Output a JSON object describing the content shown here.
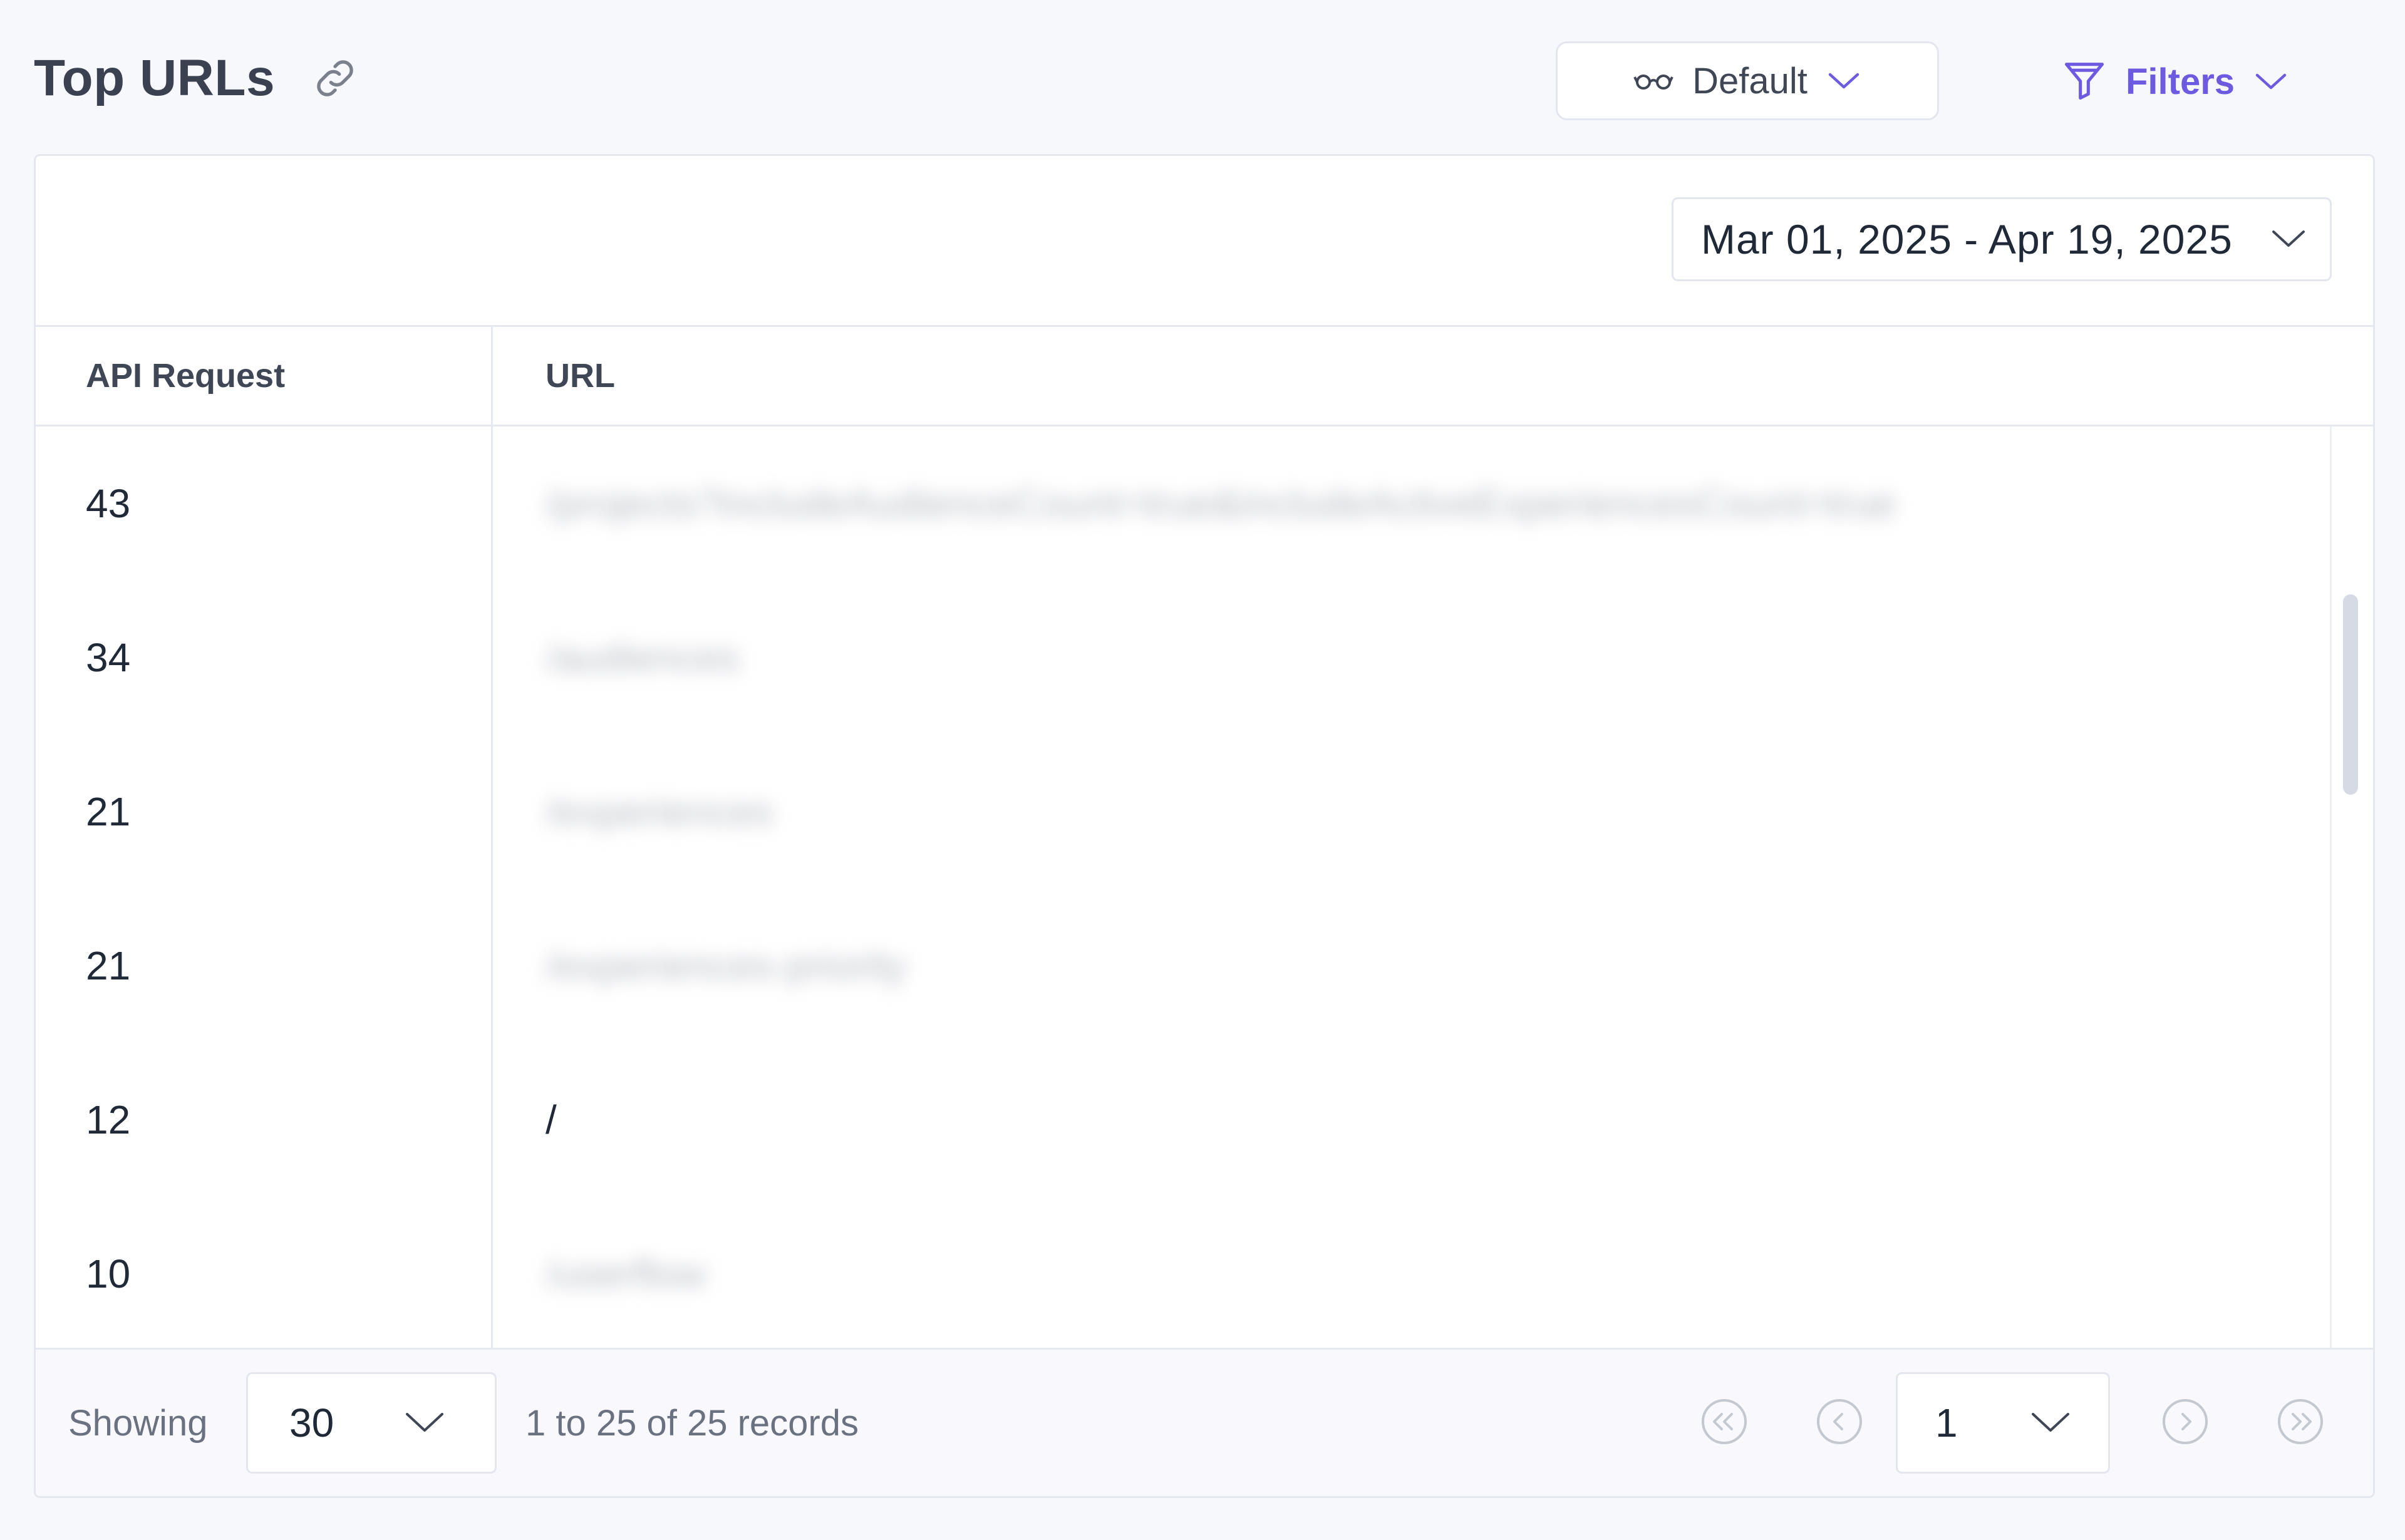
{
  "header": {
    "title": "Top URLs",
    "view_label": "Default",
    "filters_label": "Filters"
  },
  "toolbar": {
    "date_range": "Mar 01, 2025 - Apr 19, 2025"
  },
  "table": {
    "columns": [
      "API Request",
      "URL"
    ],
    "rows": [
      {
        "requests": "43",
        "url": "/projects?includeAudienceCount=true&includeActiveExperiencesCount=true",
        "blurred": true
      },
      {
        "requests": "34",
        "url": "/audiences",
        "blurred": true
      },
      {
        "requests": "21",
        "url": "/experiences",
        "blurred": true
      },
      {
        "requests": "21",
        "url": "/experiences-priority",
        "blurred": true
      },
      {
        "requests": "12",
        "url": "/",
        "blurred": false
      },
      {
        "requests": "10",
        "url": "/userflow",
        "blurred": true
      }
    ]
  },
  "footer": {
    "showing_label": "Showing",
    "page_size": "30",
    "records_text": "1 to 25 of 25 records",
    "current_page": "1"
  },
  "colors": {
    "accent": "#6c5be0",
    "border": "#e4e7ee",
    "text": "#1f2937",
    "muted": "#6a7180"
  }
}
